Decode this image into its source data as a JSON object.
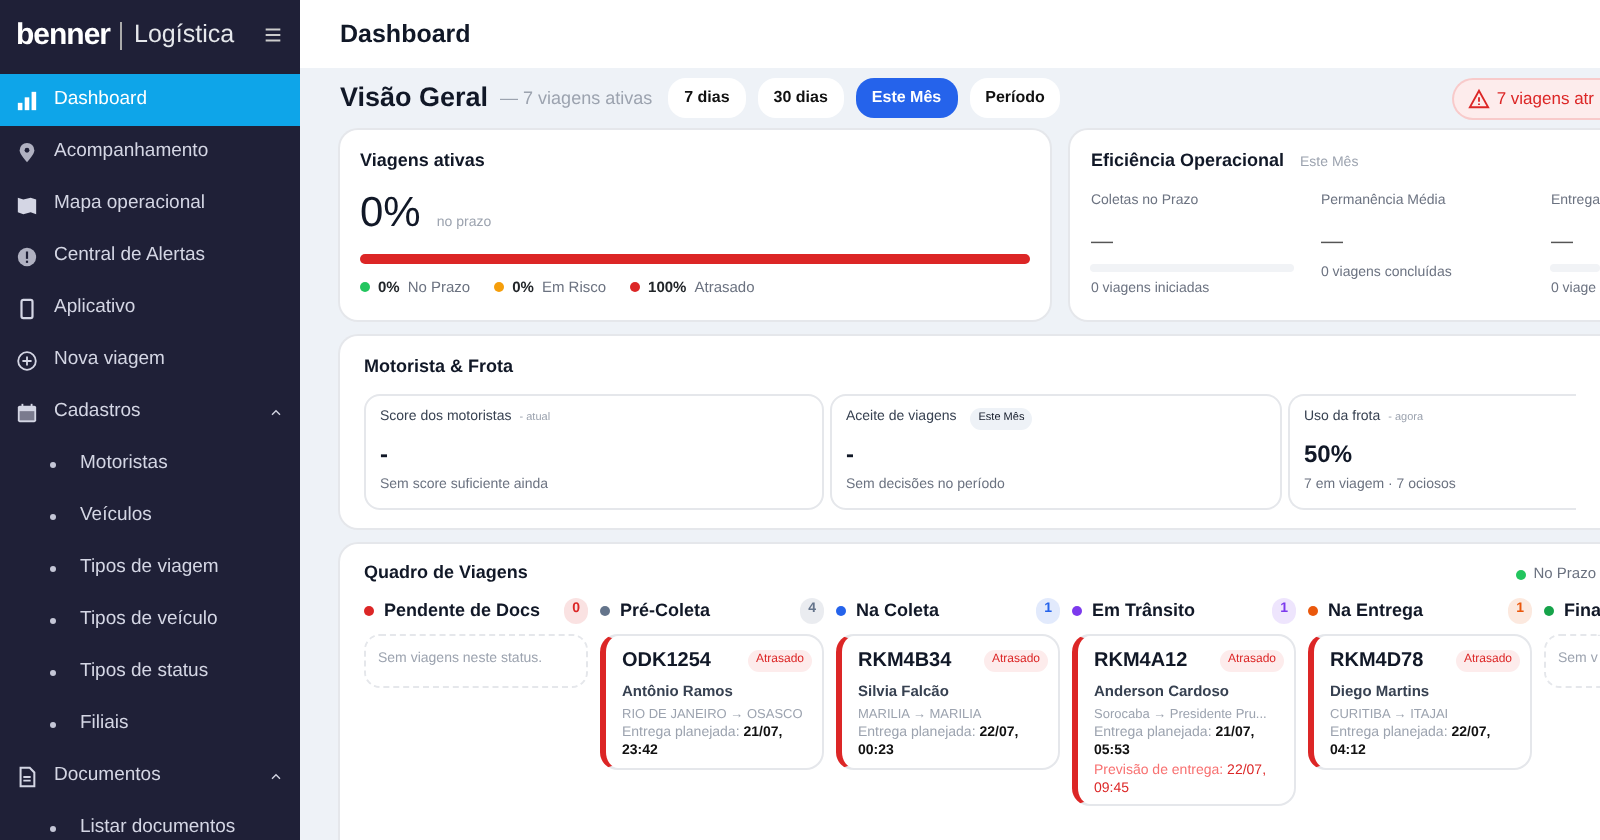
{
  "sidebar": {
    "brand": "benner",
    "product": "Logística",
    "items": [
      {
        "label": "Dashboard",
        "selected": true
      },
      {
        "label": "Acompanhamento",
        "selected": false
      },
      {
        "label": "Mapa operacional",
        "selected": false
      },
      {
        "label": "Central de Alertas",
        "selected": false
      },
      {
        "label": "Aplicativo",
        "selected": false
      },
      {
        "label": "Nova viagem",
        "selected": false
      },
      {
        "label": "Cadastros",
        "selected": false,
        "expanded": true,
        "children": [
          {
            "label": "Motoristas",
            "selected": false
          },
          {
            "label": "Veículos",
            "selected": false
          },
          {
            "label": "Tipos de viagem",
            "selected": false
          },
          {
            "label": "Tipos de veículo",
            "selected": false
          },
          {
            "label": "Tipos de status",
            "selected": false
          },
          {
            "label": "Filiais",
            "selected": false
          }
        ]
      },
      {
        "label": "Documentos",
        "selected": false,
        "expanded": true,
        "children": [
          {
            "label": "Listar documentos",
            "selected": false
          }
        ]
      }
    ]
  },
  "header": {
    "title": "Dashboard"
  },
  "overview": {
    "title": "Visão Geral",
    "subtitle": "— 7 viagens ativas",
    "periods": [
      {
        "label": "7 dias",
        "selected": false
      },
      {
        "label": "30 dias",
        "selected": false
      },
      {
        "label": "Este Mês",
        "selected": true
      },
      {
        "label": "Período",
        "selected": false
      }
    ],
    "alert": "7 viagens atr"
  },
  "active_trips": {
    "title": "Viagens ativas",
    "value": "0%",
    "caption": "no prazo",
    "segments": [
      {
        "color": "#dc2626",
        "level": 1
      }
    ],
    "legend": [
      {
        "color": "#22c55e",
        "value": "0%",
        "label": "No Prazo"
      },
      {
        "color": "#f59e0b",
        "value": "0%",
        "label": "Em Risco"
      },
      {
        "color": "#dc2626",
        "value": "100%",
        "label": "Atrasado"
      }
    ]
  },
  "efficiency": {
    "title": "Eficiência Operacional",
    "period": "Este Mês",
    "metrics": [
      {
        "kind": "bar",
        "label": "Coletas no Prazo",
        "value": "—",
        "level": 0,
        "note": "0 viagens iniciadas"
      },
      {
        "kind": "plain",
        "label": "Permanência Média",
        "value": "—",
        "note": "0 viagens concluídas"
      },
      {
        "kind": "bar",
        "label": "Entrega",
        "value": "—",
        "level": 0,
        "note": "0 viage"
      }
    ]
  },
  "fleet": {
    "title": "Motorista & Frota",
    "cards": [
      {
        "title": "Score dos motoristas",
        "note": "- atual",
        "value": "-",
        "caption": "Sem score suficiente ainda"
      },
      {
        "title": "Aceite de viagens",
        "tag": "Este Mês",
        "value": "-",
        "caption": "Sem decisões no período"
      },
      {
        "title": "Uso da frota",
        "note": "- agora",
        "value": "50%",
        "caption": "7 em viagem · 7 ociosos"
      }
    ]
  },
  "board": {
    "title": "Quadro de Viagens",
    "legend": [
      {
        "label": "No Prazo",
        "color": "#22c55e"
      }
    ],
    "columns": [
      {
        "title": "Pendente de Docs",
        "count": "0",
        "color": "#dc2626",
        "empty_text": "Sem viagens neste status."
      },
      {
        "title": "Pré-Coleta",
        "count": "4",
        "color": "#64748b",
        "trips": [
          {
            "plate": "ODK1254",
            "status": "Atrasado",
            "driver": "Antônio Ramos",
            "route": "RIO DE JANEIRO → OSASCO",
            "planned": "Entrega planejada: **21/07, 23:42**"
          }
        ]
      },
      {
        "title": "Na Coleta",
        "count": "1",
        "color": "#2563eb",
        "trips": [
          {
            "plate": "RKM4B34",
            "status": "Atrasado",
            "driver": "Silvia Falcão",
            "route": "MARILIA → MARILIA",
            "planned": "Entrega planejada: **22/07, 00:23**"
          }
        ]
      },
      {
        "title": "Em Trânsito",
        "count": "1",
        "color": "#7c3aed",
        "trips": [
          {
            "plate": "RKM4A12",
            "status": "Atrasado",
            "driver": "Anderson Cardoso",
            "route": "Sorocaba → Presidente Pru...",
            "planned": "Entrega planejada: **21/07, 05:53**",
            "forecast": "Previsão de entrega: **22/07, 09:45**"
          }
        ]
      },
      {
        "title": "Na Entrega",
        "count": "1",
        "color": "#ea580c",
        "trips": [
          {
            "plate": "RKM4D78",
            "status": "Atrasado",
            "driver": "Diego Martins",
            "route": "CURITIBA → ITAJAI",
            "planned": "Entrega planejada: **22/07, 04:12**"
          }
        ]
      },
      {
        "title": "Fina",
        "color": "#16a34a",
        "empty_text": "Sem v"
      }
    ]
  }
}
